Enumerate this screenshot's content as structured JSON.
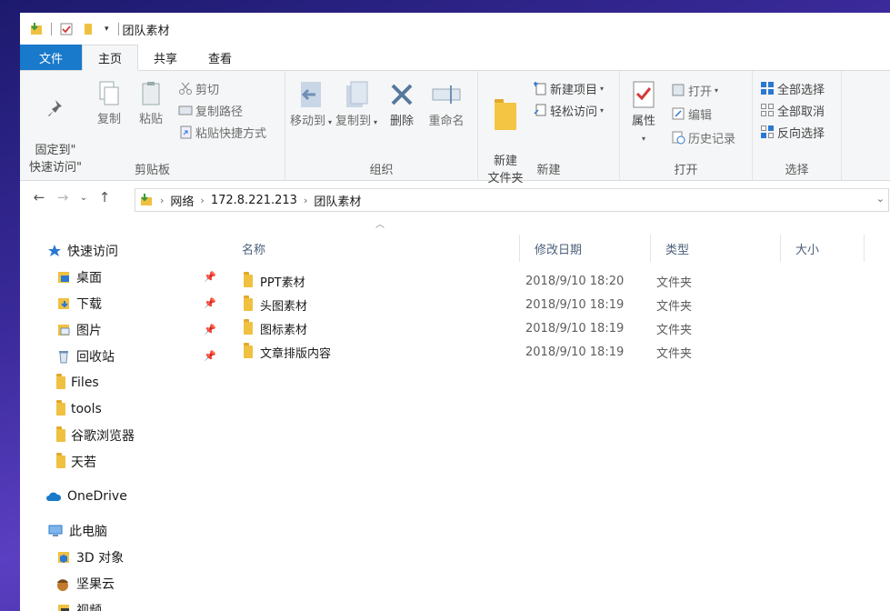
{
  "window": {
    "title": "团队素材"
  },
  "tabs": [
    {
      "label": "文件"
    },
    {
      "label": "主页"
    },
    {
      "label": "共享"
    },
    {
      "label": "查看"
    }
  ],
  "ribbon": {
    "clipboard": {
      "label": "剪贴板",
      "pin_quick": "固定到\"\n快速访问\"",
      "copy": "复制",
      "paste": "粘贴",
      "cut": "剪切",
      "copy_path": "复制路径",
      "paste_shortcut": "粘贴快捷方式"
    },
    "organize": {
      "label": "组织",
      "move_to": "移动到",
      "copy_to": "复制到",
      "delete": "删除",
      "rename": "重命名"
    },
    "new": {
      "label": "新建",
      "new_folder": "新建\n文件夹",
      "new_item": "新建项目",
      "easy_access": "轻松访问"
    },
    "open": {
      "label": "打开",
      "properties": "属性",
      "open": "打开",
      "edit": "编辑",
      "history": "历史记录"
    },
    "select": {
      "label": "选择",
      "select_all": "全部选择",
      "select_none": "全部取消",
      "invert": "反向选择"
    }
  },
  "address": {
    "crumbs": [
      "网络",
      "172.8.221.213",
      "团队素材"
    ]
  },
  "nav": {
    "quick_access": "快速访问",
    "items": [
      {
        "label": "桌面",
        "pinned": true
      },
      {
        "label": "下载",
        "pinned": true
      },
      {
        "label": "图片",
        "pinned": true
      },
      {
        "label": "回收站",
        "pinned": true
      },
      {
        "label": "Files",
        "pinned": false
      },
      {
        "label": "tools",
        "pinned": false
      },
      {
        "label": "谷歌浏览器",
        "pinned": false
      },
      {
        "label": "天若",
        "pinned": false
      }
    ],
    "onedrive": "OneDrive",
    "this_pc": "此电脑",
    "pc_items": [
      {
        "label": "3D 对象"
      },
      {
        "label": "坚果云"
      },
      {
        "label": "视频"
      }
    ]
  },
  "columns": {
    "name": "名称",
    "date": "修改日期",
    "type": "类型",
    "size": "大小"
  },
  "files": [
    {
      "name": "PPT素材",
      "date": "2018/9/10 18:20",
      "type": "文件夹"
    },
    {
      "name": "头图素材",
      "date": "2018/9/10 18:19",
      "type": "文件夹"
    },
    {
      "name": "图标素材",
      "date": "2018/9/10 18:19",
      "type": "文件夹"
    },
    {
      "name": "文章排版内容",
      "date": "2018/9/10 18:19",
      "type": "文件夹"
    }
  ],
  "colors": {
    "file_tab": "#1979ca",
    "ribbon_bg": "#f5f6f7",
    "folder": "#f0c040",
    "accent_blue": "#2b78d0"
  }
}
